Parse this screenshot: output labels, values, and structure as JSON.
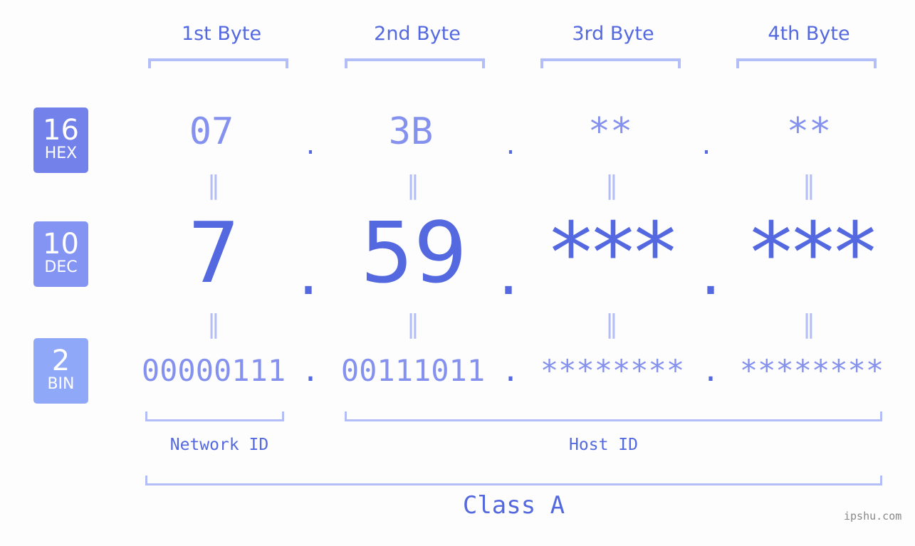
{
  "byte_headers": [
    "1st Byte",
    "2nd Byte",
    "3rd Byte",
    "4th Byte"
  ],
  "badges": {
    "hex": {
      "num": "16",
      "label": "HEX",
      "color": "#7381ea"
    },
    "dec": {
      "num": "10",
      "label": "DEC",
      "color": "#8494f2"
    },
    "bin": {
      "num": "2",
      "label": "BIN",
      "color": "#90a8f8"
    }
  },
  "hex_values": [
    "07",
    "3B",
    "**",
    "**"
  ],
  "dec_values": [
    "7",
    "59",
    "***",
    "***"
  ],
  "bin_values": [
    "00000111",
    "00111011",
    "********",
    "********"
  ],
  "separator": ".",
  "equals": "=",
  "network_label": "Network ID",
  "host_label": "Host ID",
  "class_label": "Class A",
  "watermark": "ipshu.com",
  "colors": {
    "accent": "#5468e0",
    "light": "#8491ee",
    "bracket": "#b3bdf7"
  }
}
